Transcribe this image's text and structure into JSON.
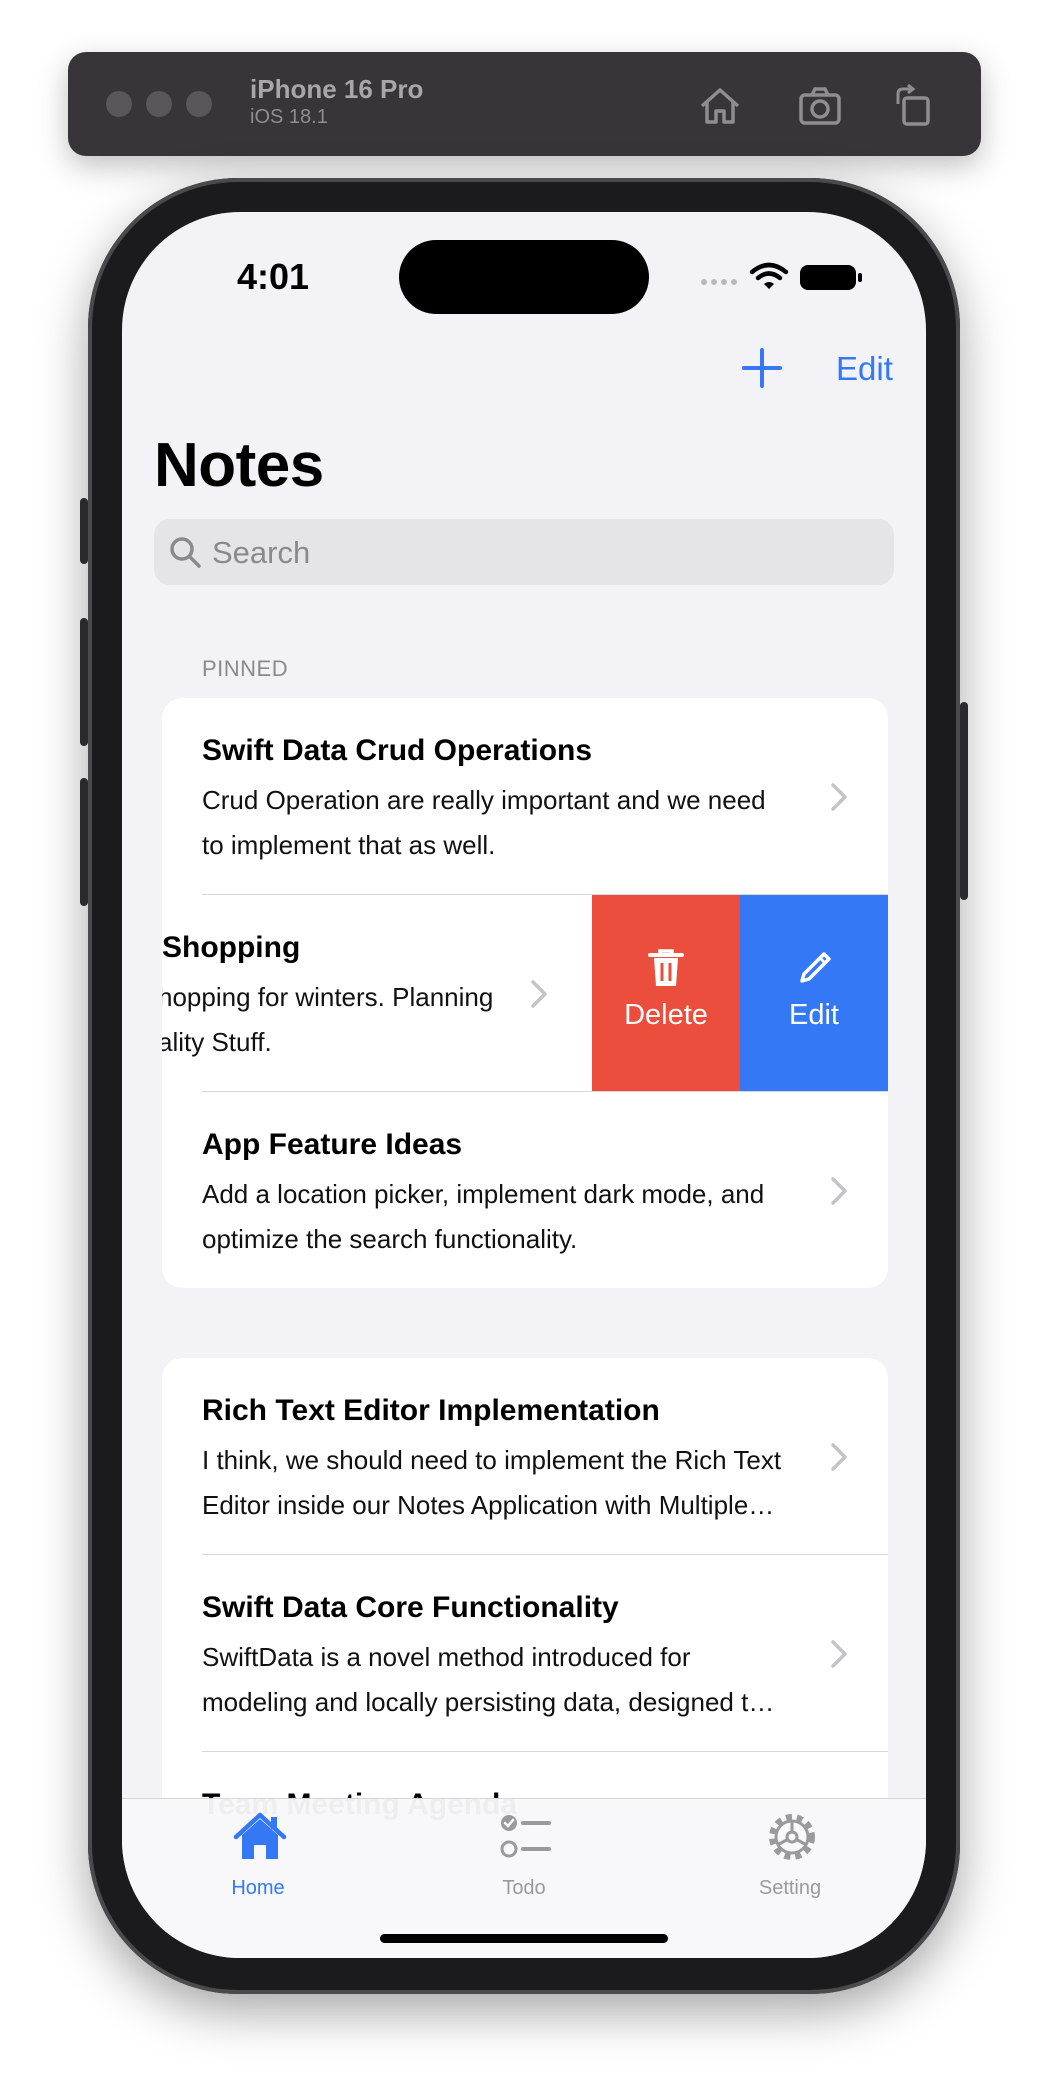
{
  "simulator": {
    "device_name": "iPhone 16 Pro",
    "os_version": "iOS 18.1"
  },
  "status_bar": {
    "time": "4:01"
  },
  "nav": {
    "edit_label": "Edit",
    "title": "Notes"
  },
  "search": {
    "placeholder": "Search"
  },
  "pinned": {
    "header": "PINNED",
    "notes": [
      {
        "title": "Swift Data Crud Operations",
        "line1": "Crud Operation are really important and we need",
        "line2": "to implement that as well."
      },
      {
        "title": "Shopping",
        "line1": "hopping for winters. Planning",
        "line2": "ality Stuff."
      },
      {
        "title": "App Feature Ideas",
        "line1": "Add a location picker, implement dark mode, and",
        "line2": "optimize the search functionality."
      }
    ]
  },
  "swipe_actions": {
    "delete_label": "Delete",
    "edit_label": "Edit"
  },
  "notes": [
    {
      "title": "Rich Text Editor Implementation",
      "line1": "I think, we should need to implement the Rich Text",
      "line2": "Editor inside our Notes Application with Multiple…"
    },
    {
      "title": "Swift Data Core Functionality",
      "line1": "SwiftData is a novel method introduced for",
      "line2": "modeling and locally persisting data, designed t…"
    },
    {
      "title": "Team Meeting Agenda"
    }
  ],
  "tabs": [
    {
      "label": "Home",
      "icon": "house-fill-icon",
      "selected": true
    },
    {
      "label": "Todo",
      "icon": "checklist-icon",
      "selected": false
    },
    {
      "label": "Setting",
      "icon": "gear-icon",
      "selected": false
    }
  ],
  "colors": {
    "accent": "#3478f6",
    "delete": "#eb4e3d",
    "background": "#f2f2f7",
    "inactive_tab": "#9a9a9e"
  }
}
